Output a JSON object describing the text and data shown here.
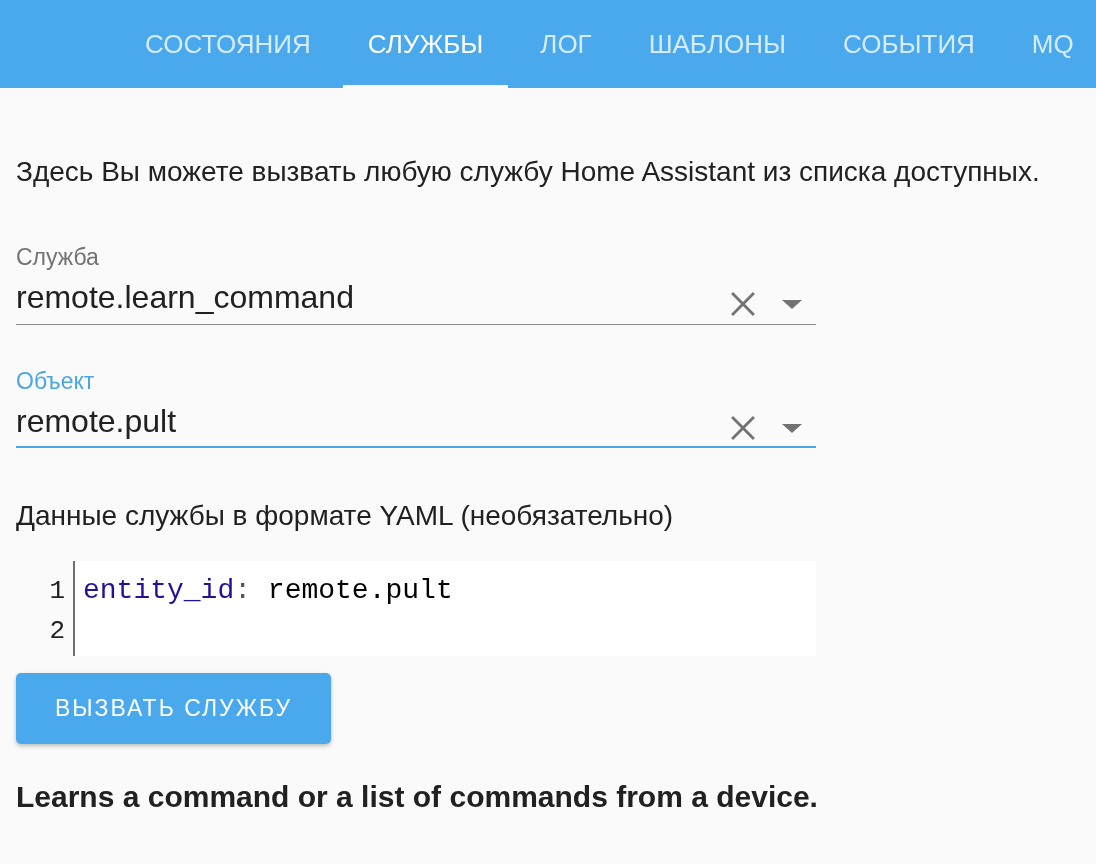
{
  "tabs": [
    {
      "label": "СОСТОЯНИЯ",
      "selected": false
    },
    {
      "label": "СЛУЖБЫ",
      "selected": true
    },
    {
      "label": "ЛОГ",
      "selected": false
    },
    {
      "label": "ШАБЛОНЫ",
      "selected": false
    },
    {
      "label": "СОБЫТИЯ",
      "selected": false
    },
    {
      "label": "MQ",
      "selected": false
    }
  ],
  "intro": "Здесь Вы можете вызвать любую службу Home Assistant из списка доступных.",
  "fields": [
    {
      "label": "Служба",
      "value": "remote.learn_command",
      "focused": false
    },
    {
      "label": "Объект",
      "value": "remote.pult",
      "focused": true
    }
  ],
  "yaml": {
    "label": "Данные службы в формате YAML (необязательно)",
    "lines": [
      {
        "number": "1",
        "tokens": [
          {
            "kind": "atom",
            "text": "entity_id"
          },
          {
            "kind": "meta",
            "text": ":"
          },
          {
            "kind": "plain",
            "text": " remote.pult"
          }
        ]
      },
      {
        "number": "2"
      }
    ]
  },
  "button": "ВЫЗВАТЬ СЛУЖБУ",
  "description": "Learns a command or a list of commands from a device."
}
